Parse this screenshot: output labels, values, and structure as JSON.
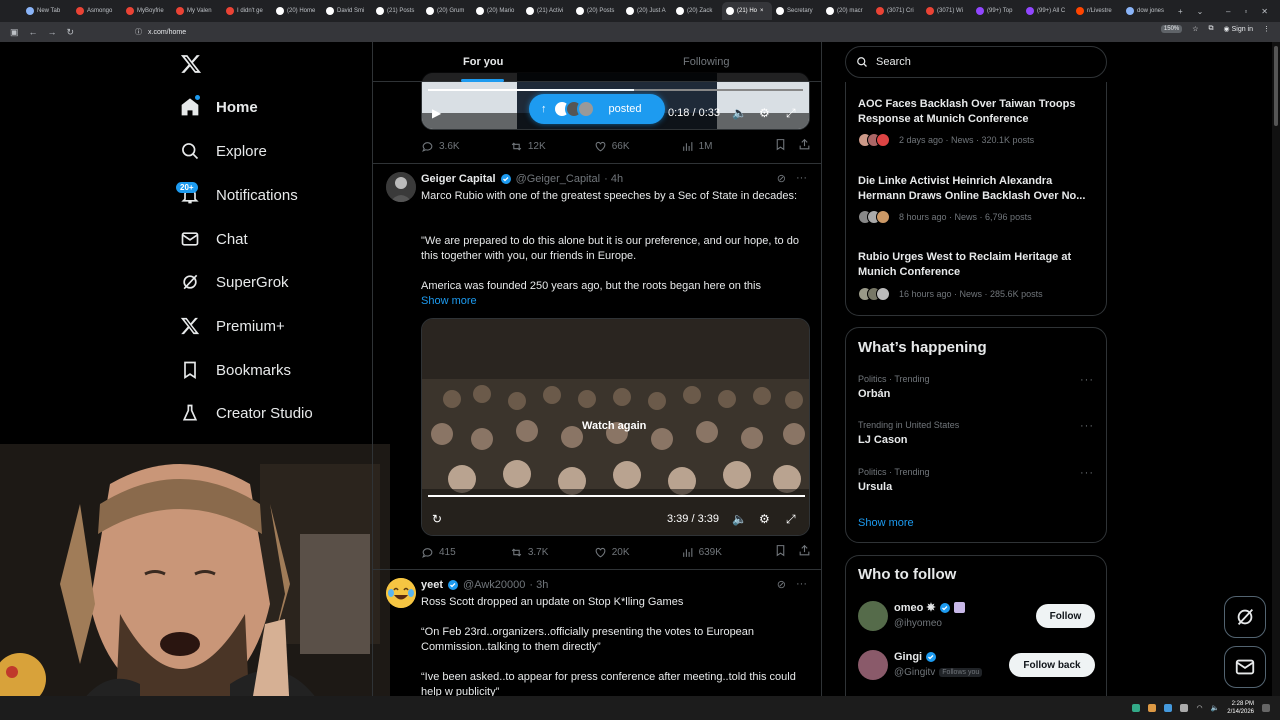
{
  "browser": {
    "tabs": [
      {
        "label": "New Tab",
        "color": "#8ab4f8",
        "active": false
      },
      {
        "label": "Asmongo",
        "color": "#ea4335",
        "active": false
      },
      {
        "label": "MyBoyfrie",
        "color": "#ea4335",
        "active": false
      },
      {
        "label": "My Valen",
        "color": "#ea4335",
        "active": false
      },
      {
        "label": "I didn't ge",
        "color": "#ea4335",
        "active": false
      },
      {
        "label": "(20) Home",
        "color": "#ffffff",
        "active": false
      },
      {
        "label": "David Smi",
        "color": "#ffffff",
        "active": false
      },
      {
        "label": "(21) Posts",
        "color": "#ffffff",
        "active": false
      },
      {
        "label": "(20) Grum",
        "color": "#ffffff",
        "active": false
      },
      {
        "label": "(20) Mario",
        "color": "#ffffff",
        "active": false
      },
      {
        "label": "(21) Activi",
        "color": "#ffffff",
        "active": false
      },
      {
        "label": "(20) Posts",
        "color": "#ffffff",
        "active": false
      },
      {
        "label": "(20) Just A",
        "color": "#ffffff",
        "active": false
      },
      {
        "label": "(20) Zack",
        "color": "#ffffff",
        "active": false
      },
      {
        "label": "(21) Ho",
        "color": "#ffffff",
        "active": true
      },
      {
        "label": "Secretary",
        "color": "#ffffff",
        "active": false
      },
      {
        "label": "(20) macr",
        "color": "#ffffff",
        "active": false
      },
      {
        "label": "(3071) Cri",
        "color": "#ea4335",
        "active": false
      },
      {
        "label": "(3071) Wi",
        "color": "#ea4335",
        "active": false
      },
      {
        "label": "(99+) Top",
        "color": "#9146ff",
        "active": false
      },
      {
        "label": "(99+) All C",
        "color": "#9146ff",
        "active": false
      },
      {
        "label": "r/Livestre",
        "color": "#ff4500",
        "active": false
      },
      {
        "label": "dow jones",
        "color": "#8ab4f8",
        "active": false
      }
    ],
    "url": "x.com/home",
    "zoom": "150%",
    "signin": "Sign in"
  },
  "nav": {
    "items": [
      {
        "label": "Home"
      },
      {
        "label": "Explore"
      },
      {
        "label": "Notifications"
      },
      {
        "label": "Chat"
      },
      {
        "label": "SuperGrok"
      },
      {
        "label": "Premium+"
      },
      {
        "label": "Bookmarks"
      },
      {
        "label": "Creator Studio"
      }
    ],
    "notif_badge": "20+"
  },
  "feed": {
    "tab_foryou": "For you",
    "tab_following": "Following",
    "first_video": {
      "posted_pill": "posted",
      "time": "0:18 / 0:33",
      "progress": 0.55
    },
    "first_stats": {
      "replies": "3.6K",
      "reposts": "12K",
      "likes": "66K",
      "views": "1M"
    },
    "tweet1": {
      "name": "Geiger Capital",
      "handle": "@Geiger_Capital",
      "time": "· 4h",
      "text1": "Marco Rubio with one of the greatest speeches by a Sec of State in decades:",
      "text2": "\"We are prepared to do this alone but it is our preference, and our hope, to do this together with you, our friends in Europe.",
      "text3": "America was founded 250 years ago, but the roots began here on this",
      "show_more": "Show more",
      "video_overlay": "Watch again",
      "video_time": "3:39 / 3:39",
      "progress": 1.0,
      "stats": {
        "replies": "415",
        "reposts": "3.7K",
        "likes": "20K",
        "views": "639K"
      }
    },
    "tweet2": {
      "name": "yeet",
      "handle": "@Awk20000",
      "time": "· 3h",
      "text1": "Ross Scott dropped an update on Stop K*lling Games",
      "text2": "“On Feb 23rd..organizers..officially presenting the votes to European Commission..talking to them directly”",
      "text3": "“Ive been asked..to appear for press conference after meeting..told this could help w publicity”"
    }
  },
  "right": {
    "search_placeholder": "Search",
    "news": [
      {
        "title": "AOC Faces Backlash Over Taiwan Troops Response at Munich Conference",
        "meta": "2 days ago · News · 320.1K posts"
      },
      {
        "title": "Die Linke Activist Heinrich Alexandra Hermann Draws Online Backlash Over No...",
        "meta": "8 hours ago · News · 6,796 posts"
      },
      {
        "title": "Rubio Urges West to Reclaim Heritage at Munich Conference",
        "meta": "16 hours ago · News · 285.6K posts"
      }
    ],
    "happening_title": "What’s happening",
    "trends": [
      {
        "category": "Politics · Trending",
        "name": "Orbán"
      },
      {
        "category": "Trending in United States",
        "name": "LJ Cason"
      },
      {
        "category": "Politics · Trending",
        "name": "Ursula"
      }
    ],
    "show_more": "Show more",
    "who_title": "Who to follow",
    "follow": [
      {
        "name": "omeo ✵",
        "handle": "@ihyomeo",
        "button": "Follow",
        "follows_you": ""
      },
      {
        "name": "Gingi",
        "handle": "@Gingitv",
        "button": "Follow back",
        "follows_you": "Follows you"
      }
    ]
  },
  "taskbar": {
    "time": "2:28 PM",
    "date": "2/14/2026"
  },
  "colors": {
    "accent": "#1d9bf0",
    "bg": "#000000",
    "border": "#2f3336",
    "muted": "#71767b"
  }
}
